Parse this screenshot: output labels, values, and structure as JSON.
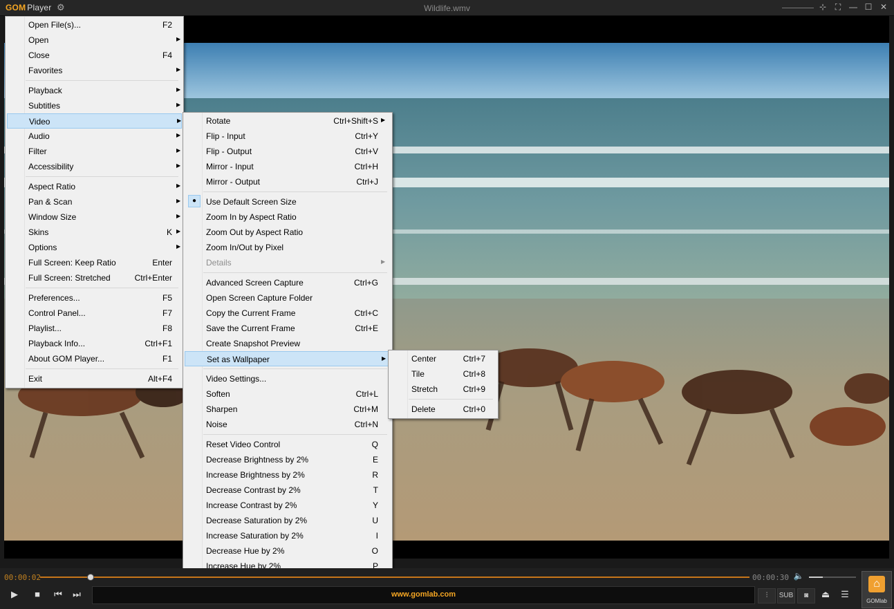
{
  "app": {
    "logo_main": "GOM",
    "logo_sub": "Player",
    "window_title": "Wildlife.wmv"
  },
  "title_buttons": {
    "pin": "⊹",
    "mini": "⛶",
    "minimize": "—",
    "maximize": "☐",
    "close": "✕"
  },
  "main_menu": {
    "items": [
      {
        "label": "Open File(s)...",
        "shortcut": "F2",
        "submenu": false
      },
      {
        "label": "Open",
        "shortcut": "",
        "submenu": true
      },
      {
        "label": "Close",
        "shortcut": "F4",
        "submenu": false
      },
      {
        "label": "Favorites",
        "shortcut": "",
        "submenu": true
      },
      {
        "label": "Playback",
        "shortcut": "",
        "submenu": true
      },
      {
        "label": "Subtitles",
        "shortcut": "",
        "submenu": true
      },
      {
        "label": "Video",
        "shortcut": "",
        "submenu": true,
        "highlighted": true
      },
      {
        "label": "Audio",
        "shortcut": "",
        "submenu": true
      },
      {
        "label": "Filter",
        "shortcut": "",
        "submenu": true
      },
      {
        "label": "Accessibility",
        "shortcut": "",
        "submenu": true
      },
      {
        "label": "Aspect Ratio",
        "shortcut": "",
        "submenu": true
      },
      {
        "label": "Pan & Scan",
        "shortcut": "",
        "submenu": true
      },
      {
        "label": "Window Size",
        "shortcut": "",
        "submenu": true
      },
      {
        "label": "Skins",
        "shortcut": "K",
        "submenu": true
      },
      {
        "label": "Options",
        "shortcut": "",
        "submenu": true
      },
      {
        "label": "Full Screen: Keep Ratio",
        "shortcut": "Enter",
        "submenu": false
      },
      {
        "label": "Full Screen: Stretched",
        "shortcut": "Ctrl+Enter",
        "submenu": false
      },
      {
        "label": "Preferences...",
        "shortcut": "F5",
        "submenu": false
      },
      {
        "label": "Control Panel...",
        "shortcut": "F7",
        "submenu": false
      },
      {
        "label": "Playlist...",
        "shortcut": "F8",
        "submenu": false
      },
      {
        "label": "Playback Info...",
        "shortcut": "Ctrl+F1",
        "submenu": false
      },
      {
        "label": "About GOM Player...",
        "shortcut": "F1",
        "submenu": false
      },
      {
        "label": "Exit",
        "shortcut": "Alt+F4",
        "submenu": false
      }
    ]
  },
  "video_menu": {
    "items": [
      {
        "label": "Rotate",
        "shortcut": "Ctrl+Shift+S",
        "submenu": true
      },
      {
        "label": "Flip - Input",
        "shortcut": "Ctrl+Y"
      },
      {
        "label": "Flip - Output",
        "shortcut": "Ctrl+V"
      },
      {
        "label": "Mirror - Input",
        "shortcut": "Ctrl+H"
      },
      {
        "label": "Mirror - Output",
        "shortcut": "Ctrl+J"
      },
      {
        "label": "Use Default Screen Size",
        "shortcut": "",
        "checked": true
      },
      {
        "label": "Zoom In by Aspect Ratio",
        "shortcut": ""
      },
      {
        "label": "Zoom Out by Aspect Ratio",
        "shortcut": ""
      },
      {
        "label": "Zoom In/Out by Pixel",
        "shortcut": ""
      },
      {
        "label": "Details",
        "shortcut": "",
        "submenu": true,
        "disabled": true
      },
      {
        "label": "Advanced Screen Capture",
        "shortcut": "Ctrl+G"
      },
      {
        "label": "Open Screen Capture Folder",
        "shortcut": ""
      },
      {
        "label": "Copy the Current Frame",
        "shortcut": "Ctrl+C"
      },
      {
        "label": "Save the Current Frame",
        "shortcut": "Ctrl+E"
      },
      {
        "label": "Create Snapshot Preview",
        "shortcut": ""
      },
      {
        "label": "Set as Wallpaper",
        "shortcut": "",
        "submenu": true,
        "highlighted": true
      },
      {
        "label": "Video Settings...",
        "shortcut": ""
      },
      {
        "label": "Soften",
        "shortcut": "Ctrl+L"
      },
      {
        "label": "Sharpen",
        "shortcut": "Ctrl+M"
      },
      {
        "label": "Noise",
        "shortcut": "Ctrl+N"
      },
      {
        "label": "Reset Video Control",
        "shortcut": "Q"
      },
      {
        "label": "Decrease Brightness by 2%",
        "shortcut": "E"
      },
      {
        "label": "Increase Brightness by 2%",
        "shortcut": "R"
      },
      {
        "label": "Decrease Contrast by 2%",
        "shortcut": "T"
      },
      {
        "label": "Increase Contrast by 2%",
        "shortcut": "Y"
      },
      {
        "label": "Decrease Saturation by 2%",
        "shortcut": "U"
      },
      {
        "label": "Increase Saturation by 2%",
        "shortcut": "I"
      },
      {
        "label": "Decrease Hue by 2%",
        "shortcut": "O"
      },
      {
        "label": "Increase Hue by 2%",
        "shortcut": "P"
      }
    ]
  },
  "wallpaper_menu": {
    "items": [
      {
        "label": "Center",
        "shortcut": "Ctrl+7"
      },
      {
        "label": "Tile",
        "shortcut": "Ctrl+8"
      },
      {
        "label": "Stretch",
        "shortcut": "Ctrl+9"
      },
      {
        "label": "Delete",
        "shortcut": "Ctrl+0"
      }
    ]
  },
  "player": {
    "current_time": "00:00:02",
    "total_time": "00:00:30",
    "progress": 0.067,
    "volume": 0.3,
    "site": "www.gomlab.com",
    "sub_label": "SUB",
    "gomlab_label": "GOMlab"
  },
  "colors": {
    "accent": "#f5a623",
    "menu_highlight": "#cce4f7",
    "seek": "#c8761a"
  }
}
